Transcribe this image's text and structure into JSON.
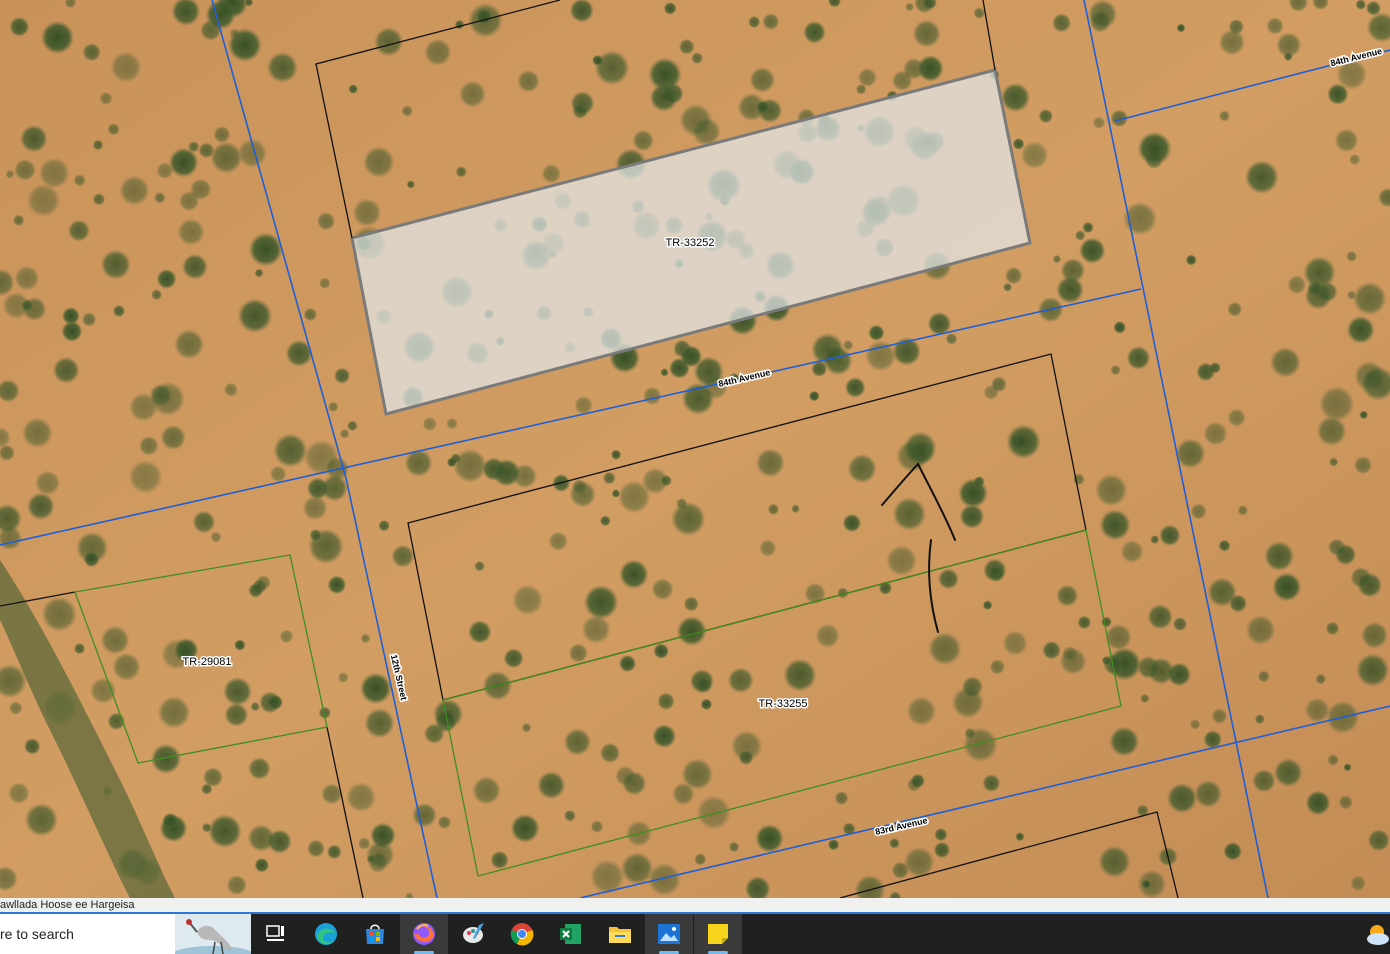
{
  "map": {
    "parcels": [
      {
        "id": "parcel-tr-33252",
        "label": "TR-33252"
      },
      {
        "id": "parcel-tr-33255",
        "label": "TR-33255"
      },
      {
        "id": "parcel-tr-29081",
        "label": "TR-29081"
      }
    ],
    "roads": [
      {
        "id": "road-84th-avenue",
        "label": "84th Avenue"
      },
      {
        "id": "road-84th-avenue-ne",
        "label": "84th Avenue"
      },
      {
        "id": "road-83rd-avenue",
        "label": "83rd Avenue"
      },
      {
        "id": "road-12th-street",
        "label": "12th Street"
      }
    ],
    "colors": {
      "road_line": "#1f5fd6",
      "parcel_boundary": "#111111",
      "selected_parcel": "#3f8f1f",
      "highlight_fill": "#dfe6ea"
    }
  },
  "statusbar": {
    "text": "awllada Hoose ee Hargeisa"
  },
  "taskbar": {
    "search_placeholder": "re to search",
    "apps": [
      {
        "name": "task-view-icon",
        "label": "Task View"
      },
      {
        "name": "edge-icon",
        "label": "Microsoft Edge"
      },
      {
        "name": "store-icon",
        "label": "Microsoft Store"
      },
      {
        "name": "firefox-icon",
        "label": "Firefox"
      },
      {
        "name": "paint-icon",
        "label": "Paint"
      },
      {
        "name": "chrome-icon",
        "label": "Google Chrome"
      },
      {
        "name": "excel-icon",
        "label": "Excel"
      },
      {
        "name": "file-explorer-icon",
        "label": "File Explorer"
      },
      {
        "name": "photos-icon",
        "label": "Photos"
      },
      {
        "name": "sticky-notes-icon",
        "label": "Sticky Notes"
      }
    ],
    "tray": {
      "weather_icon": "weather-sun-cloud-icon"
    }
  }
}
